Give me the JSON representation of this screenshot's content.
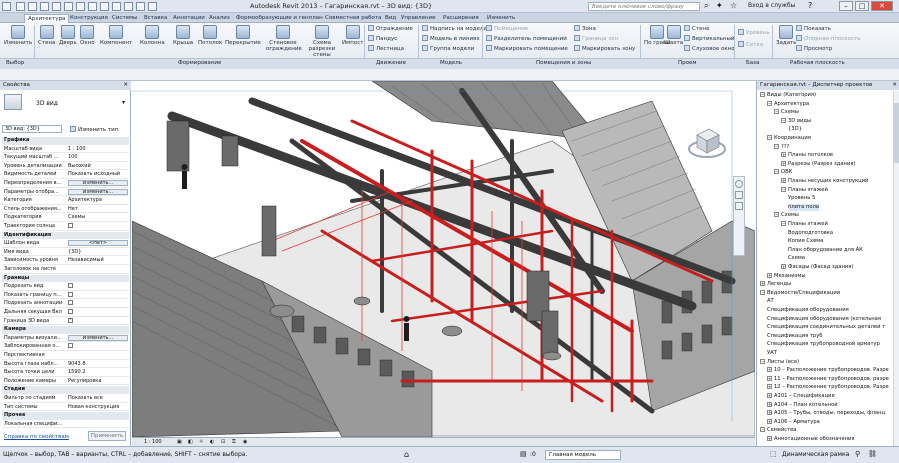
{
  "app": {
    "title": "Autodesk Revit 2013 – Гагаринская.rvt – 3D вид: {3D}",
    "search_placeholder": "Введите ключевое слово/фразу",
    "login": "Вход в службы"
  },
  "tabs": [
    "Архитектура",
    "Конструкция",
    "Системы",
    "Вставка",
    "Аннотации",
    "Анализ",
    "Формообразующие и генплан",
    "Совместная работа",
    "Вид",
    "Управление",
    "Расширения",
    "Изменить"
  ],
  "active_tab": "Архитектура",
  "ribbon": {
    "select": "Изменить",
    "build": [
      "Стена",
      "Дверь",
      "Окно",
      "Компонент",
      "Колонна",
      "Крыша",
      "Потолок",
      "Перекрытие",
      "Стеновое ограждение",
      "Схема разрезки стены",
      "Импост"
    ],
    "circulation": [
      "Ограждение",
      "Пандус",
      "Лестница"
    ],
    "model": [
      "Надпись на модели",
      "Модель в линиях",
      "Группа модели"
    ],
    "room": [
      "Помещение",
      "Разделитель помещений",
      "Маркировать помещение"
    ],
    "area": [
      "Зона",
      "Граница зон",
      "Маркировать зону"
    ],
    "opening": [
      "По грани",
      "Шахта"
    ],
    "opening_small": [
      "Стена",
      "Вертикальный",
      "Слуховое окно"
    ],
    "datum": [
      "Уровень",
      "Сетка"
    ],
    "workplane": [
      "Задать",
      "Показать",
      "Опорная плоскость",
      "Просмотр"
    ],
    "groups": [
      "Выбор",
      "Формирование",
      "Движение",
      "Модель",
      "Помещения и зоны",
      "Проем",
      "База",
      "Рабочая плоскость"
    ]
  },
  "properties": {
    "header": "Свойства",
    "type_name": "3D вид",
    "selector": "3D вид: {3D}",
    "edit_type": "Изменить тип",
    "rows": [
      {
        "k": "Графика",
        "v": "",
        "cat": true
      },
      {
        "k": "Масштаб вида",
        "v": "1 : 100"
      },
      {
        "k": "Текущий масштаб ...",
        "v": "100"
      },
      {
        "k": "Уровень детализации",
        "v": "Высокий"
      },
      {
        "k": "Видимость деталей",
        "v": "Показать исходный"
      },
      {
        "k": "Переопределения в...",
        "v": "Изменить...",
        "btn": true
      },
      {
        "k": "Параметры отобра...",
        "v": "Изменить...",
        "btn": true
      },
      {
        "k": "Категория",
        "v": "Архитектура"
      },
      {
        "k": "Стиль отображения...",
        "v": "Нет"
      },
      {
        "k": "Подкатегория",
        "v": "Схемы"
      },
      {
        "k": "Траектория солнца",
        "v": "",
        "check": false
      },
      {
        "k": "Идентификация",
        "v": "",
        "cat": true
      },
      {
        "k": "Шаблон вида",
        "v": "<Нет>",
        "btn": true
      },
      {
        "k": "Имя вида",
        "v": "{3D}"
      },
      {
        "k": "Зависимость уровня",
        "v": "Независимый"
      },
      {
        "k": "Заголовок на листе",
        "v": ""
      },
      {
        "k": "Границы",
        "v": "",
        "cat": true
      },
      {
        "k": "Подрезать вид",
        "v": "",
        "check": false
      },
      {
        "k": "Показать границу п...",
        "v": "",
        "check": false
      },
      {
        "k": "Подрезать аннотации",
        "v": "",
        "check": false
      },
      {
        "k": "Дальняя секущая Вкл",
        "v": "",
        "check": false
      },
      {
        "k": "Граница 3D вида",
        "v": "",
        "check": true
      },
      {
        "k": "Камера",
        "v": "",
        "cat": true
      },
      {
        "k": "Параметры визуали...",
        "v": "Изменить...",
        "btn": true
      },
      {
        "k": "Заблокированная о...",
        "v": "",
        "check": false
      },
      {
        "k": "Перспективная",
        "v": ""
      },
      {
        "k": "Высота глаза набл...",
        "v": "9043.8"
      },
      {
        "k": "Высота точки цели",
        "v": "1590.2"
      },
      {
        "k": "Положение камеры",
        "v": "Регулировка"
      },
      {
        "k": "Стадии",
        "v": "",
        "cat": true
      },
      {
        "k": "Фильтр по стадиям",
        "v": "Показать все"
      },
      {
        "k": "Тип системы",
        "v": "Новая конструкция"
      },
      {
        "k": "Прочее",
        "v": "",
        "cat": true
      },
      {
        "k": "Локальная специфи...",
        "v": ""
      }
    ],
    "help_link": "Справка по свойствам",
    "apply": "Применить"
  },
  "browser": {
    "header": "Гагаринская.rvt – Диспетчер проектов",
    "rows": [
      {
        "t": "Виды (Категория)",
        "lvl": 0,
        "tog": "-"
      },
      {
        "t": "Архитектура",
        "lvl": 1,
        "tog": "-"
      },
      {
        "t": "Схемы",
        "lvl": 2,
        "tog": "-"
      },
      {
        "t": "3D виды",
        "lvl": 3,
        "tog": "-"
      },
      {
        "t": "{3D}",
        "lvl": 4
      },
      {
        "t": "Координация",
        "lvl": 1,
        "tog": "-"
      },
      {
        "t": "???",
        "lvl": 2,
        "tog": "-"
      },
      {
        "t": "Планы потолков",
        "lvl": 3,
        "tog": "+"
      },
      {
        "t": "Разрезы (Разрез здания)",
        "lvl": 3,
        "tog": "+"
      },
      {
        "t": "ОВК",
        "lvl": 2,
        "tog": "-"
      },
      {
        "t": "Планы несущих конструкций",
        "lvl": 3,
        "tog": "+"
      },
      {
        "t": "Планы этажей",
        "lvl": 3,
        "tog": "-"
      },
      {
        "t": "Уровень 5",
        "lvl": 4
      },
      {
        "t": "плита пола",
        "lvl": 4,
        "sel": true
      },
      {
        "t": "Схемы",
        "lvl": 2,
        "tog": "-"
      },
      {
        "t": "Планы этажей",
        "lvl": 3,
        "tog": "-"
      },
      {
        "t": "Водоподготовка",
        "lvl": 4
      },
      {
        "t": "Копия Схема",
        "lvl": 4
      },
      {
        "t": "План оборудование для АК",
        "lvl": 4
      },
      {
        "t": "Схема",
        "lvl": 4
      },
      {
        "t": "Фасады (Фасад здания)",
        "lvl": 3,
        "tog": "+"
      },
      {
        "t": "Механизмы",
        "lvl": 1,
        "tog": "+"
      },
      {
        "t": "Легенды",
        "lvl": 0,
        "tog": "+"
      },
      {
        "t": "Ведомости/Спецификации",
        "lvl": 0,
        "tog": "-"
      },
      {
        "t": "АТ",
        "lvl": 1
      },
      {
        "t": "Спецификация оборудования",
        "lvl": 1
      },
      {
        "t": "Спецификация оборудования (котельная",
        "lvl": 1
      },
      {
        "t": "Спецификация соединительных деталей т",
        "lvl": 1
      },
      {
        "t": "Спецификация труб",
        "lvl": 1
      },
      {
        "t": "Спецификация трубопроводной арматур",
        "lvl": 1
      },
      {
        "t": "УАТ",
        "lvl": 1
      },
      {
        "t": "Листы (все)",
        "lvl": 0,
        "tog": "-"
      },
      {
        "t": "10 – Расположение трубопроводов. Разре",
        "lvl": 1,
        "tog": "+"
      },
      {
        "t": "11 – Расположение трубопроводов. разре",
        "lvl": 1,
        "tog": "+"
      },
      {
        "t": "12 – Расположение трубопроводов. Разре",
        "lvl": 1,
        "tog": "+"
      },
      {
        "t": "А101 – Спецификация",
        "lvl": 1,
        "tog": "+"
      },
      {
        "t": "А104 – План котельной",
        "lvl": 1,
        "tog": "+"
      },
      {
        "t": "А105 – Трубы, отводы, переходы, фланц",
        "lvl": 1,
        "tog": "+"
      },
      {
        "t": "А106 – Арматура",
        "lvl": 1,
        "tog": "+"
      },
      {
        "t": "Семейства",
        "lvl": 0,
        "tog": "-"
      },
      {
        "t": "Аннотационные обозначения",
        "lvl": 1,
        "tog": "+"
      }
    ]
  },
  "view_control": {
    "scale": "1 : 100"
  },
  "status": {
    "hint": "Щелчок – выбор, TAB – варианты, CTRL – добавление, SHIFT – снятие выбора.",
    "model": "Главная модель",
    "coord": ":0",
    "dynamic": "Динамическая рамка"
  }
}
